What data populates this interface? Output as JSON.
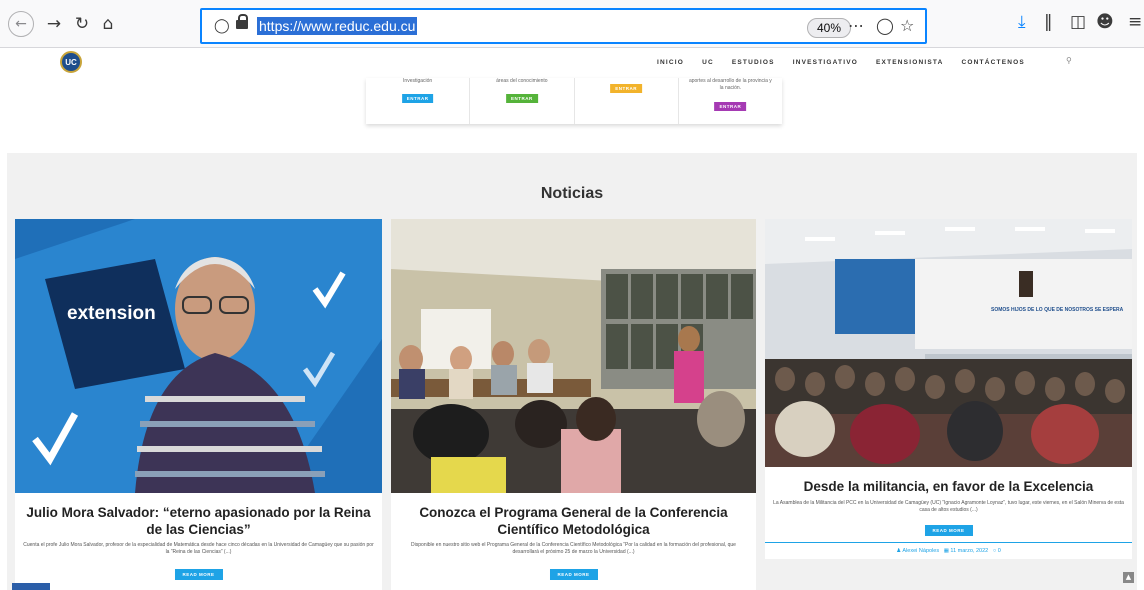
{
  "browser": {
    "url": "https://www.reduc.edu.cu",
    "zoom": "40%"
  },
  "site": {
    "nav": [
      "INICIO",
      "UC",
      "ESTUDIOS",
      "INVESTIGATIVO",
      "EXTENSIONISTA",
      "CONTÁCTENOS"
    ]
  },
  "strip": {
    "cells": [
      {
        "text": "Investigación",
        "button": "ENTRAR",
        "color": "#1ea3e6"
      },
      {
        "text": "áreas del conocimiento",
        "button": "ENTRAR",
        "color": "#55b33a"
      },
      {
        "text": "",
        "button": "ENTRAR",
        "color": "#f2b32b"
      },
      {
        "text": "aportes al desarrollo de la provincia y la nación.",
        "button": "ENTRAR",
        "color": "#a53ab3"
      }
    ]
  },
  "news": {
    "title": "Noticias",
    "cards": [
      {
        "heading": "Julio Mora Salvador: “eterno apasionado por la Reina de las Ciencias”",
        "excerpt": "Cuenta el profe Julio Mora Salvador, profesor de la especialidad de Matemática desde hace cinco décadas en la Universidad de Camagüey que su pasión por la “Reina de las Ciencias” (...)",
        "read_more": "READ MORE",
        "image_word": "extension"
      },
      {
        "heading": "Conozca el Programa General de la Conferencia Científico Metodológica",
        "excerpt": "Disponible en nuestro sitio web el Programa General de la Conferencia Científico Metodológica “Por la calidad en la formación del profesional, que desarrollará el próximo 25 de marzo la Universidad (...)",
        "read_more": "READ MORE"
      },
      {
        "heading": "Desde la militancia, en favor de la Excelencia",
        "excerpt": "La Asamblea de la Militancia del PCC en la Universidad de Camagüey (UC) “Ignacio Agramonte Loynaz”, tuvo lugar, este viernes, en el Salón Minerva de esta casa de altos estudios (...)",
        "read_more": "READ MORE",
        "author": "Alexei Nápoles",
        "date": "11 marzo, 2022",
        "comments": "0",
        "banner": "SOMOS HIJOS DE LO QUE DE NOSOTROS SE ESPERA"
      }
    ]
  },
  "colors": {
    "accent": "#1ea3e6",
    "url_highlight": "#2b6fd6",
    "browser_focus": "#0a84ff"
  }
}
